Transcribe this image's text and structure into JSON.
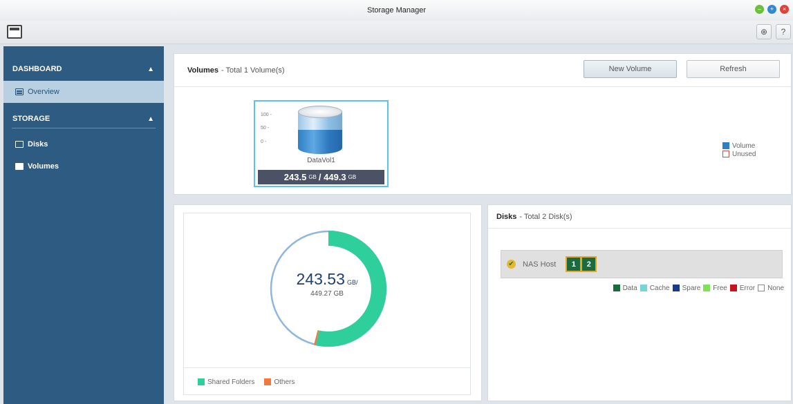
{
  "window": {
    "title": "Storage Manager",
    "min_icon": "minimize-icon",
    "max_icon": "maximize-icon",
    "close_icon": "close-icon"
  },
  "toolbar": {
    "settings_glyph": "⊕",
    "help_glyph": "?"
  },
  "sidebar": {
    "sections": [
      {
        "label": "DASHBOARD",
        "items": [
          {
            "label": "Overview",
            "icon": "overview-icon"
          }
        ]
      },
      {
        "label": "STORAGE",
        "items": [
          {
            "label": "Disks",
            "icon": "disk-icon"
          },
          {
            "label": "Volumes",
            "icon": "volume-icon"
          }
        ]
      }
    ]
  },
  "volumes_panel": {
    "title": "Volumes",
    "subtitle": "- Total 1 Volume(s)",
    "new_volume_label": "New Volume",
    "refresh_label": "Refresh",
    "volume": {
      "name": "DataVol1",
      "used": "243.5",
      "total": "449.3",
      "unit": "GB",
      "scale": [
        "100 -",
        "50 -",
        "0 -"
      ],
      "used_fraction": 0.54
    },
    "legend": [
      {
        "label": "Volume",
        "color": "#2f7fc4"
      },
      {
        "label": "Unused",
        "color": "#ffffff"
      }
    ]
  },
  "usage_panel": {
    "used": "243.53",
    "used_unit": "GB/",
    "total": "449.27 GB",
    "shared_fraction": 0.535,
    "others_fraction": 0.005,
    "legend": [
      {
        "label": "Shared Folders",
        "color": "#2fcf9b"
      },
      {
        "label": "Others",
        "color": "#ef7a3c"
      }
    ]
  },
  "disks_panel": {
    "title": "Disks",
    "subtitle": "- Total 2 Disk(s)",
    "host_label": "NAS Host",
    "disks": [
      "1",
      "2"
    ],
    "legend": [
      {
        "label": "Data",
        "color": "#1b6b3f"
      },
      {
        "label": "Cache",
        "color": "#76d6d6"
      },
      {
        "label": "Spare",
        "color": "#1a3a8c"
      },
      {
        "label": "Free",
        "color": "#7fe05a"
      },
      {
        "label": "Error",
        "color": "#c8141c"
      },
      {
        "label": "None",
        "color": "#ffffff"
      }
    ]
  }
}
